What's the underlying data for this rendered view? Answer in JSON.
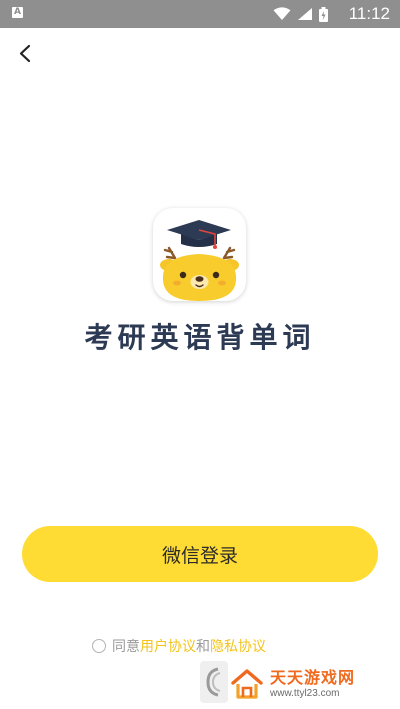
{
  "status_bar": {
    "notification_icon_letter": "A",
    "time": "11:12",
    "icons": [
      "wifi-icon",
      "signal-icon",
      "battery-icon"
    ]
  },
  "nav": {
    "back_icon": "chevron-left-icon"
  },
  "app": {
    "logo_icon": "deer-graduate-logo",
    "name": "考研英语背单词"
  },
  "login": {
    "button_label": "微信登录"
  },
  "agreement": {
    "prefix": "同意",
    "user_agreement": "用户协议",
    "and": "和",
    "privacy_agreement": "隐私协议",
    "checked": false
  },
  "watermark": {
    "title": "天天游戏网",
    "url": "www.ttyl23.com"
  },
  "colors": {
    "accent_yellow": "#fedc33",
    "title_navy": "#2d3a54",
    "link_yellow": "#f3c41b",
    "status_bar_gray": "#8f8f8f",
    "watermark_orange": "#ef6a1f"
  }
}
